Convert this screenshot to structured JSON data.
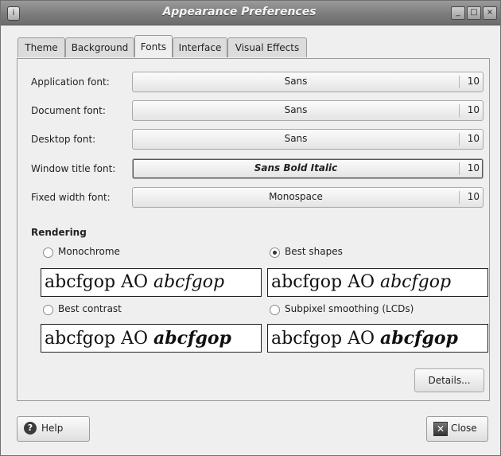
{
  "window": {
    "title": "Appearance Preferences",
    "controls": {
      "minimize": "_",
      "maximize": "□",
      "close": "×"
    }
  },
  "tabs": [
    {
      "label": "Theme",
      "active": false
    },
    {
      "label": "Background",
      "active": false
    },
    {
      "label": "Fonts",
      "active": true
    },
    {
      "label": "Interface",
      "active": false
    },
    {
      "label": "Visual Effects",
      "active": false
    }
  ],
  "fonts": [
    {
      "label": "Application font:",
      "value": "Sans",
      "size": "10"
    },
    {
      "label": "Document font:",
      "value": "Sans",
      "size": "10"
    },
    {
      "label": "Desktop font:",
      "value": "Sans",
      "size": "10"
    },
    {
      "label": "Window title font:",
      "value": "Sans Bold Italic",
      "size": "10"
    },
    {
      "label": "Fixed width font:",
      "value": "Monospace",
      "size": "10"
    }
  ],
  "rendering": {
    "title": "Rendering",
    "options": [
      {
        "label": "Monochrome",
        "selected": false,
        "sample_plain": "abcfgop AO ",
        "sample_italic": "abcfgop"
      },
      {
        "label": "Best shapes",
        "selected": true,
        "sample_plain": "abcfgop AO ",
        "sample_italic": "abcfgop"
      },
      {
        "label": "Best contrast",
        "selected": false,
        "sample_plain": "abcfgop AO ",
        "sample_italic": "abcfgop"
      },
      {
        "label": "Subpixel smoothing (LCDs)",
        "selected": false,
        "sample_plain": "abcfgop AO ",
        "sample_italic": "abcfgop"
      }
    ]
  },
  "buttons": {
    "details": "Details...",
    "help": "Help",
    "close": "Close"
  },
  "icons": {
    "app": "appearance-icon",
    "help": "help-icon",
    "close": "close-icon"
  }
}
